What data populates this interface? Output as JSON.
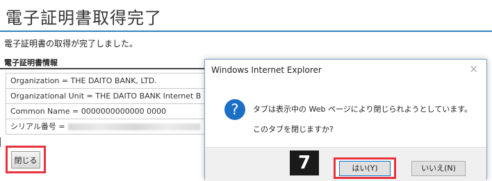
{
  "page": {
    "title": "電子証明書取得完了",
    "completion_message": "電子証明書の取得が完了しました。",
    "section_title": "電子証明書情報",
    "cert_rows": [
      "Organization = THE DAITO BANK, LTD.",
      "Organizational Unit = THE DAITO BANK Internet B",
      "Common Name =  0000000000000 0000",
      "シリアル番号 ="
    ],
    "close_button": "閉じる"
  },
  "dialog": {
    "title": "Windows Internet Explorer",
    "close_glyph": "✕",
    "icon_glyph": "?",
    "message_line1": "タブは表示中の Web ページにより閉じられようとしています。",
    "message_line2": "このタブを閉じますか?",
    "yes_button": "はい(Y)",
    "no_button": "いいえ(N)",
    "step_number": "7"
  },
  "colors": {
    "highlight": "#e8323c",
    "accent_blue": "#2e83c2",
    "icon_blue": "#1d6fc6"
  }
}
